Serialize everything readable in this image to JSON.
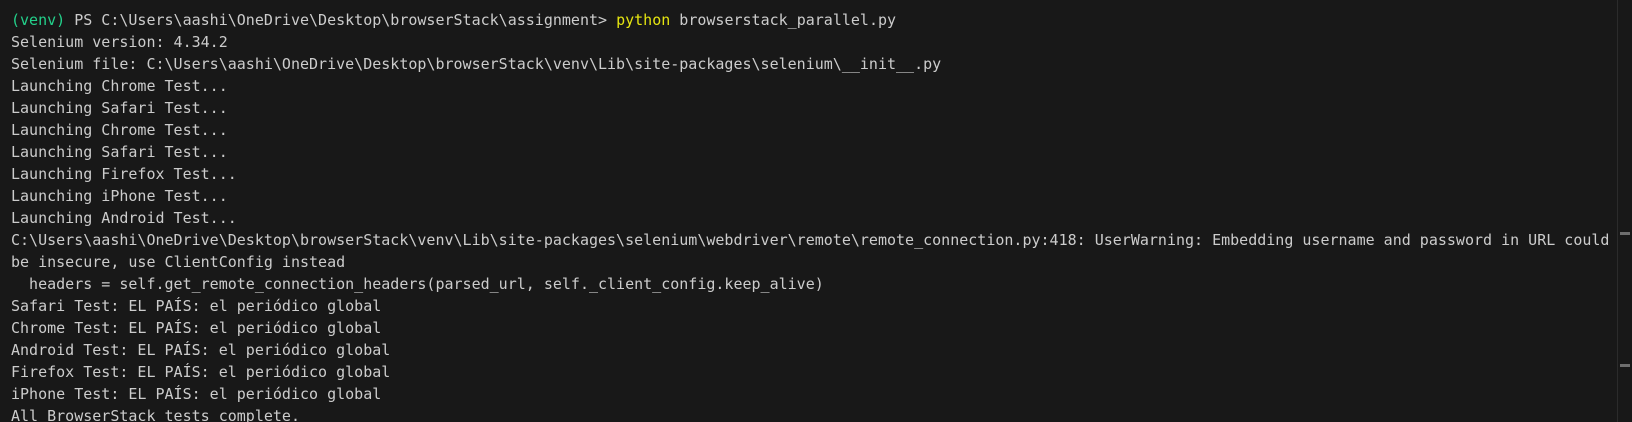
{
  "terminal": {
    "lines": [
      "> [redacted] assignment\\browserstack_parallel.py",
      "",
      "Selenium version: 4.34.2",
      "Selenium file: C:\\Users\\aashi\\OneDrive\\Desktop\\browserStack\\venv\\Lib\\site-packages\\selenium\\__init__.py",
      "Launching Chrome Test...",
      "Launching Safari Test...",
      "Launching Chrome Test...",
      "Launching Safari Test...",
      "Launching Firefox Test...",
      "Launching iPhone Test...",
      "Launching Android Test...",
      "C:\\Users\\aashi\\OneDrive\\Desktop\\browserStack\\venv\\Lib\\site-packages\\selenium\\webdriver\\remote\\remote_connection.py:418: UserWarning: Embedding username and password in URL could",
      "be insecure, use ClientConfig instead",
      "  headers = self.get_remote_connection_headers(parsed_url, self._client_config.keep_alive)",
      "Safari Test: EL PAÍS: el periódico global",
      "Chrome Test: EL PAÍS: el periódico global",
      "Android Test: EL PAÍS: el periódico global",
      "Firefox Test: EL PAÍS: el periódico global",
      "iPhone Test: EL PAÍS: el periódico global",
      "All BrowserStack tests complete."
    ],
    "prompt": {
      "venv": "(venv)",
      "ps": " PS C:\\Users\\aashi\\OneDrive\\Desktop\\browserStack\\assignment> ",
      "command": "python",
      "args": " browserstack_parallel.py"
    }
  },
  "colors": {
    "background": "#181818",
    "text": "#cccccc",
    "venv": "#23d18b",
    "command": "#e5e510"
  }
}
